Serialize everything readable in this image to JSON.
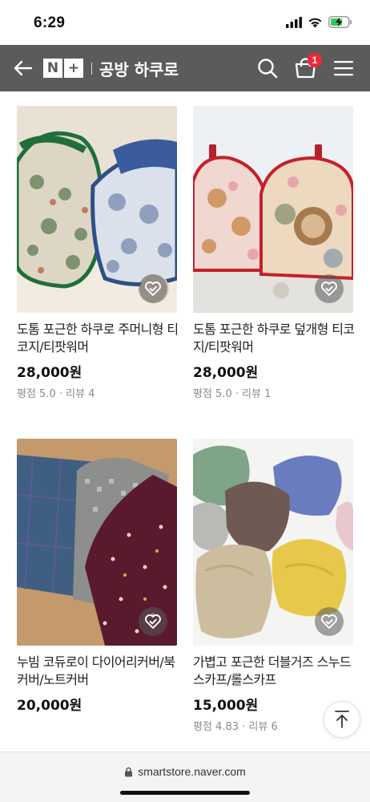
{
  "status_bar": {
    "time": "6:29"
  },
  "header": {
    "logo_n": "N",
    "logo_plus": "+",
    "store_name": "공방 하쿠로",
    "cart_count": "1",
    "icons": [
      "back-arrow-icon",
      "search-icon",
      "shopping-bag-icon",
      "menu-icon"
    ]
  },
  "products": [
    {
      "title": "도톰 포근한 하쿠로 주머니형 티코지/티팟워머",
      "price": "28,000원",
      "rating": "평점 5.0 · 리뷰 4"
    },
    {
      "title": "도톰 포근한 하쿠로 덮개형 티코지/티팟워머",
      "price": "28,000원",
      "rating": "평점 5.0 · 리뷰 1"
    },
    {
      "title": "누빔 코듀로이 다이어리커버/북커버/노트커버",
      "price": "20,000원",
      "rating": ""
    },
    {
      "title": "가볍고 포근한 더블거즈 스누드 스카프/롤스카프",
      "price": "15,000원",
      "rating": "평점 4.83 · 리뷰 6"
    }
  ],
  "bottom_bar": {
    "url": "smartstore.naver.com"
  },
  "colors": {
    "header_bg": "#5b5b5b",
    "badge": "#f0263b"
  }
}
